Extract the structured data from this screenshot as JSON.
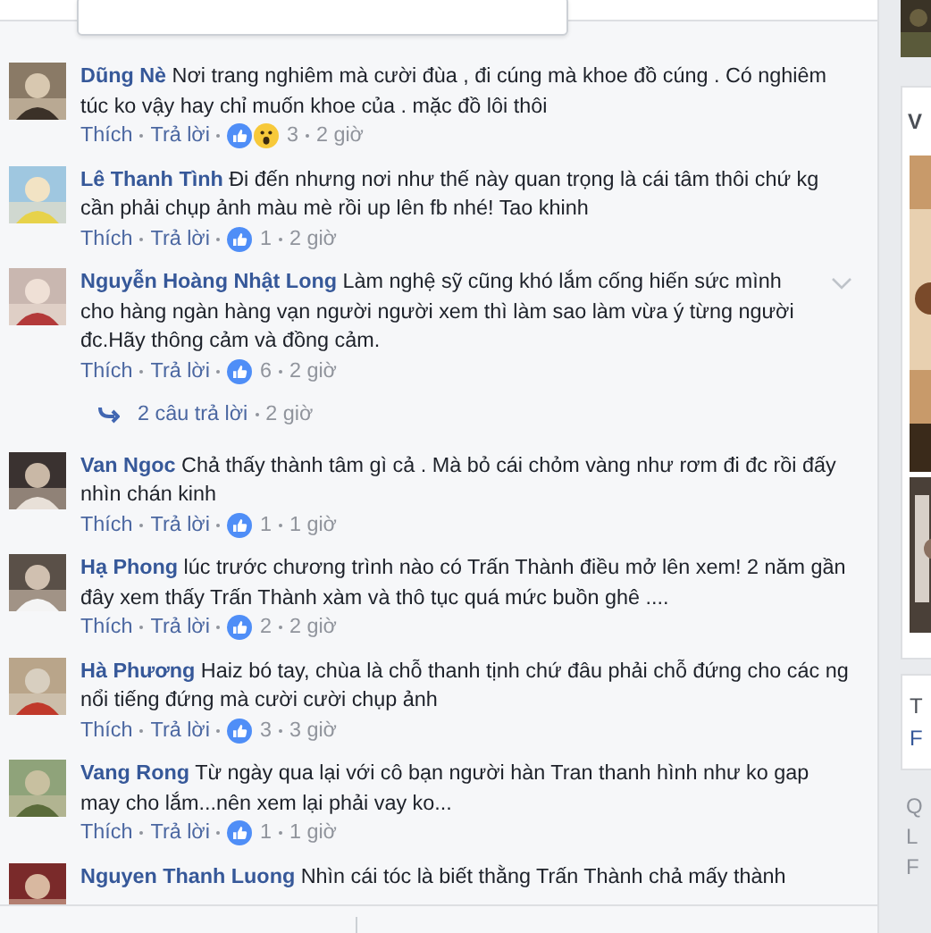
{
  "comments": [
    {
      "name": "Dũng Nè",
      "text": "Nơi trang nghiêm mà cười đùa , đi cúng mà khoe đồ cúng . Có nghiêm túc ko vậy hay chỉ muốn khoe của . mặc đồ lôi thôi",
      "actions": [
        "Thích",
        "Trả lời"
      ],
      "reactions": [
        {
          "kind": "like"
        },
        {
          "kind": "wow"
        }
      ],
      "count": "3",
      "time": "2 giờ",
      "menu_visible": false
    },
    {
      "name": "Lê Thanh Tình",
      "text": "Đi đến nhưng nơi như thế này quan trọng là cái tâm thôi chứ kg cần phải chụp ảnh màu mè rồi up lên fb nhé! Tao khinh",
      "actions": [
        "Thích",
        "Trả lời"
      ],
      "reactions": [
        {
          "kind": "like"
        }
      ],
      "count": "1",
      "time": "2 giờ",
      "menu_visible": false
    },
    {
      "name": "Nguyễn Hoàng Nhật Long",
      "text": "Làm nghệ sỹ cũng khó lắm cống hiến sức mình cho hàng ngàn hàng vạn người người xem thì làm sao làm vừa ý từng người đc.Hãy thông cảm và đồng cảm.",
      "actions": [
        "Thích",
        "Trả lời"
      ],
      "reactions": [
        {
          "kind": "like"
        }
      ],
      "count": "6",
      "time": "2 giờ",
      "menu_visible": true,
      "replies": {
        "label": "2 câu trả lời",
        "time": "2 giờ"
      }
    },
    {
      "name": "Van Ngoc",
      "text": "Chả thấy thành tâm gì cả . Mà bỏ cái chỏm vàng như rơm đi đc rồi đấy nhìn chán kinh",
      "actions": [
        "Thích",
        "Trả lời"
      ],
      "reactions": [
        {
          "kind": "like"
        }
      ],
      "count": "1",
      "time": "1 giờ",
      "menu_visible": false
    },
    {
      "name": "Hạ Phong",
      "text": "lúc trước chương trình nào có Trấn Thành điều mở lên xem! 2 năm gần đây xem thấy Trấn Thành xàm và thô tục quá mức buồn ghê ....",
      "actions": [
        "Thích",
        "Trả lời"
      ],
      "reactions": [
        {
          "kind": "like"
        }
      ],
      "count": "2",
      "time": "2 giờ",
      "menu_visible": false
    },
    {
      "name": "Hà Phương",
      "text": "Haiz bó tay, chùa là chỗ thanh tịnh chứ đâu phải chỗ đứng cho các ng nổi tiếng đứng mà cười cười chụp ảnh",
      "actions": [
        "Thích",
        "Trả lời"
      ],
      "reactions": [
        {
          "kind": "like"
        }
      ],
      "count": "3",
      "time": "3 giờ",
      "menu_visible": false
    },
    {
      "name": "Vang Rong",
      "text": "Từ ngày qua lại với cô bạn người hàn Tran thanh hình như ko gap may cho lắm...nên xem lại phải vay ko...",
      "actions": [
        "Thích",
        "Trả lời"
      ],
      "reactions": [
        {
          "kind": "like"
        }
      ],
      "count": "1",
      "time": "1 giờ",
      "menu_visible": false
    },
    {
      "name": "Nguyen Thanh Luong",
      "text": "Nhìn cái tóc là biết thằng Trấn Thành chả mấy thành",
      "menu_visible": false
    }
  ],
  "sidebar": {
    "card_title": "V",
    "card2_lines": [
      {
        "text": "T",
        "kind": "plain"
      },
      {
        "text": "F",
        "kind": "link"
      }
    ],
    "footer_lines": [
      "Q",
      "L",
      "F"
    ]
  }
}
